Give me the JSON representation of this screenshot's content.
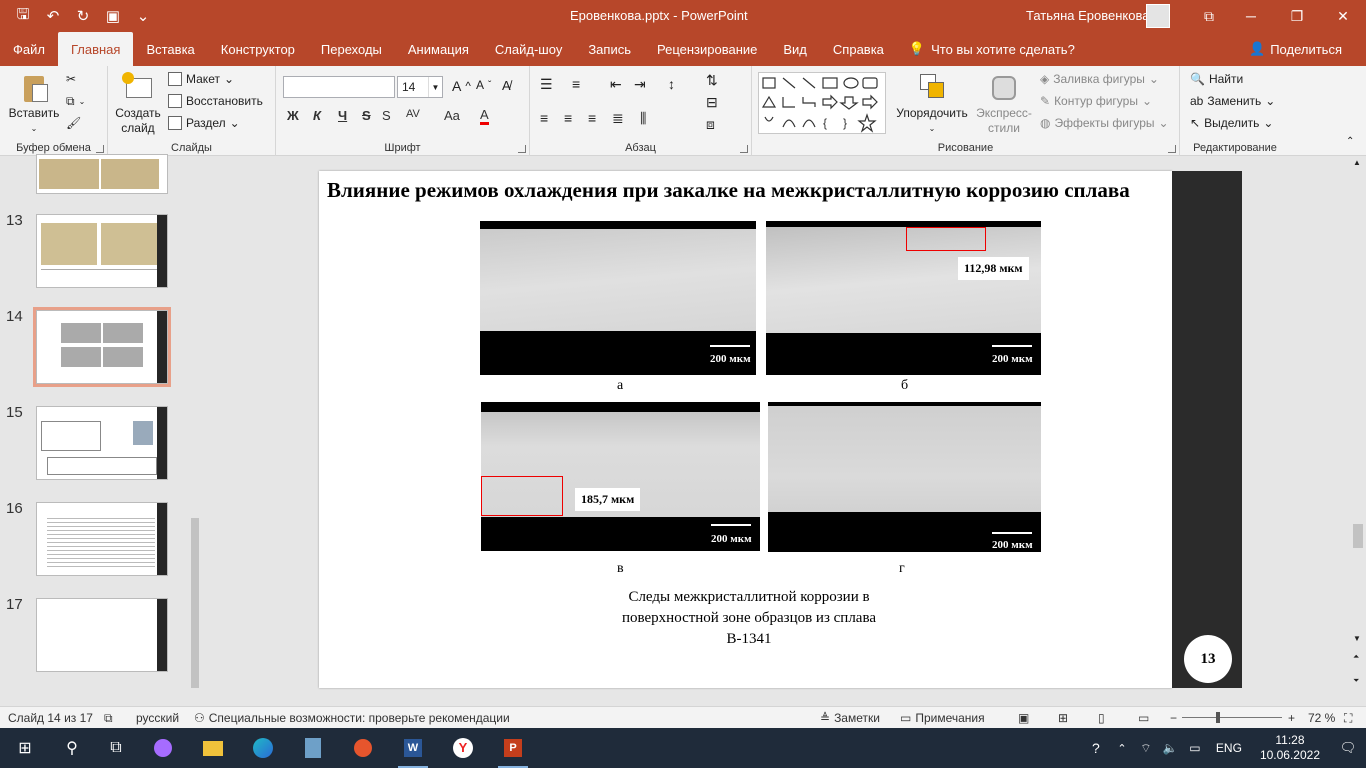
{
  "titlebar": {
    "doc_title": "Еровенкова.pptx  -  PowerPoint",
    "user": "Татьяна Еровенкова"
  },
  "tabs": [
    "Файл",
    "Главная",
    "Вставка",
    "Конструктор",
    "Переходы",
    "Анимация",
    "Слайд-шоу",
    "Запись",
    "Рецензирование",
    "Вид",
    "Справка"
  ],
  "tell_me": "Что вы хотите сделать?",
  "share": "Поделиться",
  "ribbon": {
    "clipboard": {
      "paste": "Вставить",
      "label": "Буфер обмена"
    },
    "slides": {
      "new_slide": "Создать слайд",
      "layout": "Макет",
      "reset": "Восстановить",
      "section": "Раздел",
      "label": "Слайды"
    },
    "font": {
      "font_name": "",
      "font_size": "14",
      "label": "Шрифт",
      "bold": "Ж",
      "italic": "К",
      "underline": "Ч",
      "strike": "S",
      "case": "Aa"
    },
    "paragraph": {
      "label": "Абзац"
    },
    "drawing": {
      "arrange": "Упорядочить",
      "quick_styles": "Экспресс-стили",
      "fill": "Заливка фигуры",
      "outline": "Контур фигуры",
      "effects": "Эффекты фигуры",
      "label": "Рисование"
    },
    "editing": {
      "find": "Найти",
      "replace": "Заменить",
      "select": "Выделить",
      "label": "Редактирование"
    }
  },
  "thumbnails": [
    {
      "num": "13"
    },
    {
      "num": "14"
    },
    {
      "num": "15"
    },
    {
      "num": "16"
    },
    {
      "num": "17"
    }
  ],
  "slide": {
    "title": "Влияние режимов охлаждения при закалке на межкристаллитную коррозию сплава",
    "panels": [
      {
        "letter": "а",
        "scale": "200 мкм"
      },
      {
        "letter": "б",
        "scale": "200 мкм",
        "callout": "112,98 мкм"
      },
      {
        "letter": "в",
        "scale": "200 мкм",
        "callout": "185,7 мкм"
      },
      {
        "letter": "г",
        "scale": "200 мкм"
      }
    ],
    "caption": "Следы межкристаллитной коррозии в поверхностной зоне образцов из сплава В-1341",
    "page_number": "13"
  },
  "statusbar": {
    "slide_info": "Слайд 14 из 17",
    "language": "русский",
    "accessibility": "Специальные возможности: проверьте рекомендации",
    "notes": "Заметки",
    "comments": "Примечания",
    "zoom": "72 %"
  },
  "taskbar": {
    "lang": "ENG",
    "time": "11:28",
    "date": "10.06.2022"
  },
  "colors": {
    "accent": "#b7472a",
    "taskbar": "#1f2b3a"
  }
}
